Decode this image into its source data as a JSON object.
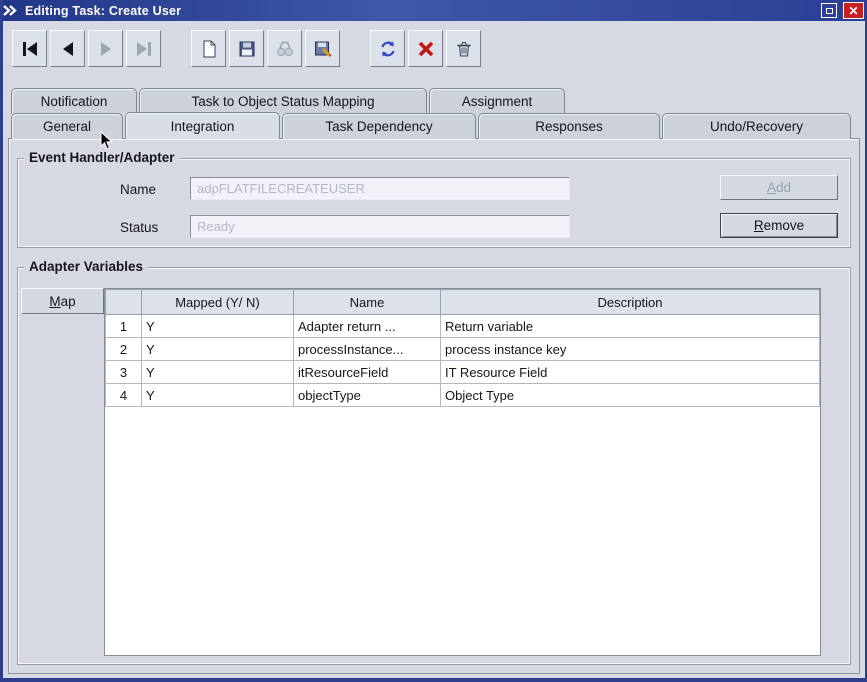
{
  "window": {
    "title": "Editing Task: Create User"
  },
  "toolbar": {
    "icons": [
      "first-record-icon",
      "previous-record-icon",
      "next-record-icon",
      "last-record-icon",
      "new-form-icon",
      "save-form-icon",
      "find-icon",
      "save-as-icon",
      "refresh-icon",
      "delete-icon",
      "trash-icon"
    ]
  },
  "tabs": {
    "row1": [
      "Notification",
      "Task to Object Status Mapping",
      "Assignment"
    ],
    "row2": [
      "General",
      "Integration",
      "Task Dependency",
      "Responses",
      "Undo/Recovery"
    ],
    "active": "Integration"
  },
  "event_handler": {
    "legend": "Event Handler/Adapter",
    "name_label": "Name",
    "name_value": "adpFLATFILECREATEUSER",
    "status_label": "Status",
    "status_value": "Ready",
    "add_label": "Add",
    "remove_label": "Remove"
  },
  "adapter_variables": {
    "legend": "Adapter Variables",
    "map_label": "Map",
    "table": {
      "headers": [
        "",
        "Mapped (Y/ N)",
        "Name",
        "Description"
      ],
      "rows": [
        [
          "1",
          "Y",
          "Adapter return ...",
          "Return variable"
        ],
        [
          "2",
          "Y",
          "processInstance...",
          "process instance key"
        ],
        [
          "3",
          "Y",
          "itResourceField",
          "IT Resource Field"
        ],
        [
          "4",
          "Y",
          "objectType",
          "Object Type"
        ]
      ]
    }
  }
}
